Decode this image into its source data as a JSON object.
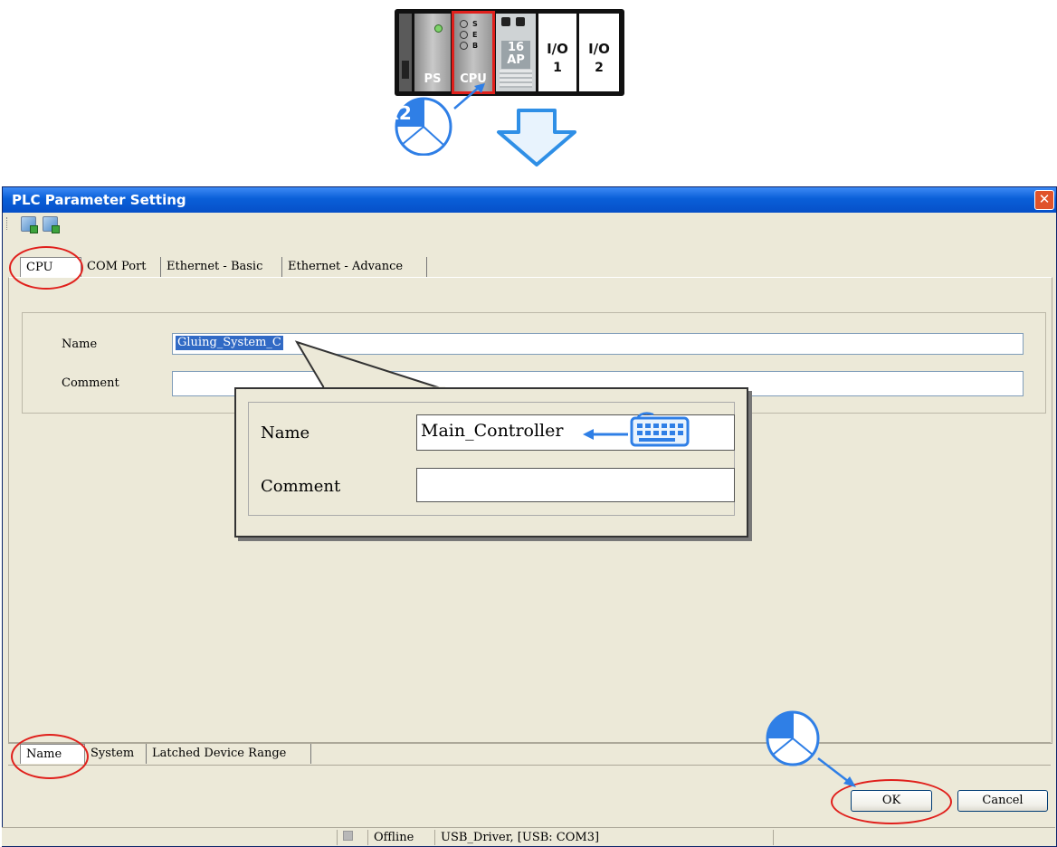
{
  "rack": {
    "modules": [
      {
        "label": "PS"
      },
      {
        "label": "CPU",
        "leds": [
          "S",
          "E",
          "B"
        ]
      },
      {
        "label_top": "16",
        "label_bottom": "AP"
      },
      {
        "label_top": "I/O",
        "label_bottom": "1"
      },
      {
        "label_top": "I/O",
        "label_bottom": "2"
      }
    ],
    "double_click_badge": "x2"
  },
  "dialog": {
    "title": "PLC Parameter Setting",
    "close_glyph": "✕",
    "top_tabs": [
      "CPU",
      "COM Port",
      "Ethernet - Basic",
      "Ethernet - Advance"
    ],
    "active_top_tab": "CPU",
    "fields": {
      "name_label": "Name",
      "name_value": "Gluing_System_C",
      "comment_label": "Comment",
      "comment_value": ""
    },
    "bottom_tabs": [
      "Name",
      "System",
      "Latched Device Range"
    ],
    "active_bottom_tab": "Name",
    "buttons": {
      "ok": "OK",
      "cancel": "Cancel"
    }
  },
  "callout": {
    "name_label": "Name",
    "name_value": "Main_Controller",
    "comment_label": "Comment",
    "comment_value": ""
  },
  "statusbar": {
    "connection": "Offline",
    "driver": "USB_Driver, [USB: COM3]"
  },
  "colors": {
    "highlight": "#e0201c",
    "arrow": "#2f7fe6",
    "titlebar": "#0a5fd8",
    "dialog_bg": "#ece9d8"
  }
}
